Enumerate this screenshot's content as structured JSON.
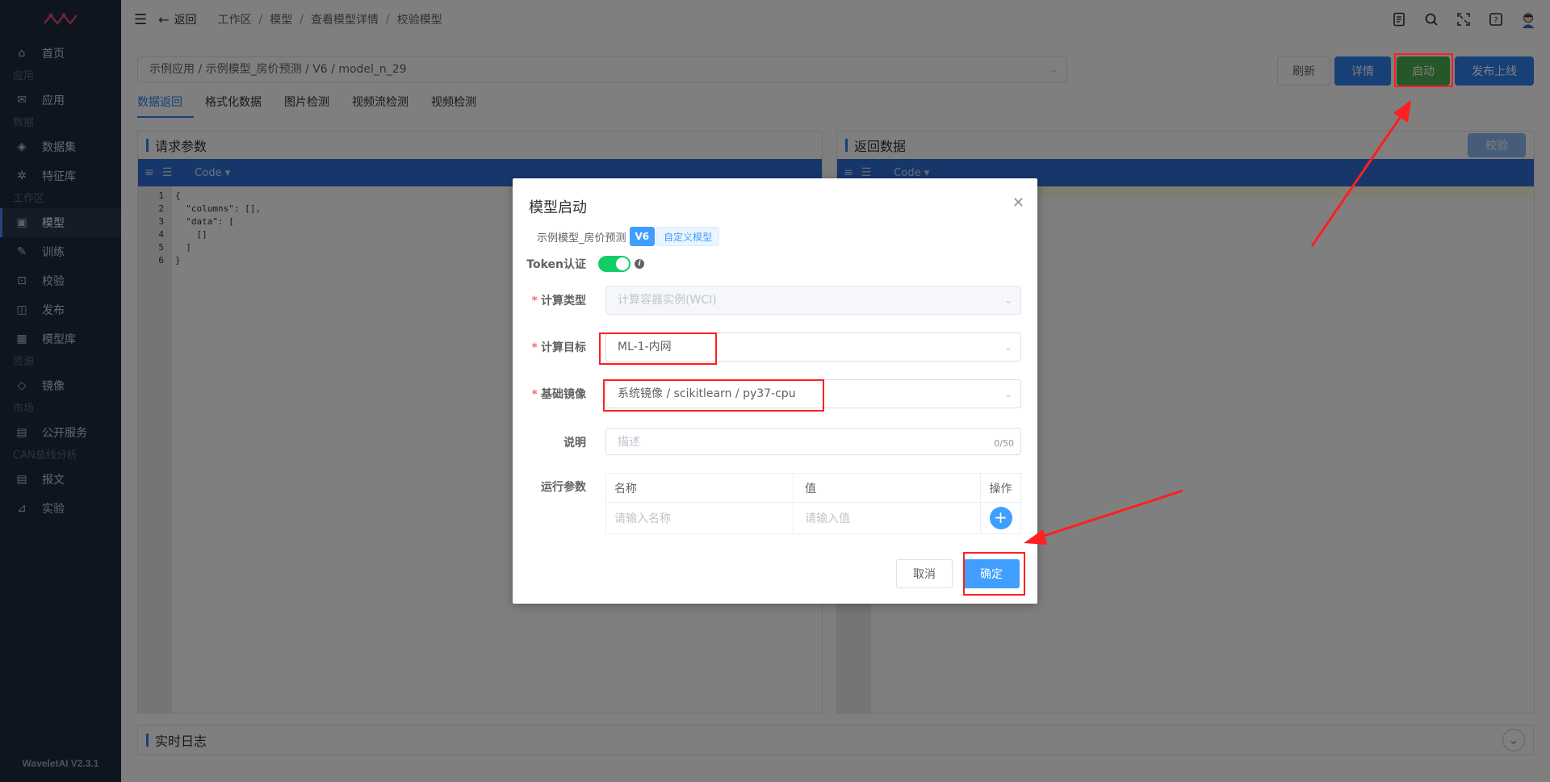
{
  "sidebar": {
    "items": [
      {
        "type": "item",
        "label": "首页",
        "icon": "home-icon"
      },
      {
        "type": "group",
        "label": "应用"
      },
      {
        "type": "item",
        "label": "应用",
        "icon": "inbox-icon"
      },
      {
        "type": "group",
        "label": "数据"
      },
      {
        "type": "item",
        "label": "数据集",
        "icon": "cube-icon"
      },
      {
        "type": "item",
        "label": "特征库",
        "icon": "nodes-icon"
      },
      {
        "type": "group",
        "label": "工作区"
      },
      {
        "type": "item",
        "label": "模型",
        "icon": "box-icon",
        "active": true
      },
      {
        "type": "item",
        "label": "训练",
        "icon": "training-icon"
      },
      {
        "type": "item",
        "label": "校验",
        "icon": "scan-icon"
      },
      {
        "type": "item",
        "label": "发布",
        "icon": "publish-icon"
      },
      {
        "type": "item",
        "label": "模型库",
        "icon": "warehouse-icon"
      },
      {
        "type": "group",
        "label": "资源"
      },
      {
        "type": "item",
        "label": "镜像",
        "icon": "layers-icon"
      },
      {
        "type": "group",
        "label": "市场"
      },
      {
        "type": "item",
        "label": "公开服务",
        "icon": "store-icon"
      },
      {
        "type": "group",
        "label": "CAN总线分析"
      },
      {
        "type": "item",
        "label": "报文",
        "icon": "document-icon"
      },
      {
        "type": "item",
        "label": "实验",
        "icon": "chart-icon"
      }
    ],
    "version": "WaveletAI V2.3.1"
  },
  "topbar": {
    "back_label": "返回",
    "breadcrumb": [
      "工作区",
      "模型",
      "查看模型详情",
      "校验模型"
    ]
  },
  "main": {
    "model_path": "示例应用 / 示例模型_房价预测 / V6 / model_n_29",
    "buttons": {
      "refresh": "刷新",
      "detail": "详情",
      "start": "启动",
      "publish": "发布上线"
    },
    "tabs": [
      "数据返回",
      "格式化数据",
      "图片检测",
      "视频流检测",
      "视频检测"
    ],
    "request_panel": {
      "title": "请求参数",
      "mode": "Code ▾"
    },
    "response_panel": {
      "title": "返回数据",
      "mode": "Code ▾",
      "validate": "校验"
    },
    "code_lines": [
      "1",
      "2",
      "3",
      "4",
      "5",
      "6"
    ],
    "code_text": "{\n  \"columns\": [],\n  \"data\": [\n    []\n  ]\n}",
    "log_title": "实时日志"
  },
  "dialog": {
    "title": "模型启动",
    "model_name": "示例模型_房价预测",
    "version_tag": "V6",
    "type_tag": "自定义模型",
    "token_label": "Token认证",
    "compute_type_label": "计算类型",
    "compute_type_value": "计算容器实例(WCI)",
    "compute_target_label": "计算目标",
    "compute_target_value": "ML-1-内网",
    "base_image_label": "基础镜像",
    "base_image_value": "系统镜像 / scikitlearn / py37-cpu",
    "desc_label": "说明",
    "desc_placeholder": "描述",
    "desc_count": "0/50",
    "run_params_label": "运行参数",
    "table_headers": {
      "name": "名称",
      "value": "值",
      "action": "操作"
    },
    "name_placeholder": "请输入名称",
    "value_placeholder": "请输入值",
    "cancel": "取消",
    "confirm": "确定"
  },
  "colors": {
    "sidebar_bg": "#1d2a3f",
    "primary": "#2f80ed",
    "success": "#4caf50",
    "annotation_red": "#ff1f1f"
  }
}
